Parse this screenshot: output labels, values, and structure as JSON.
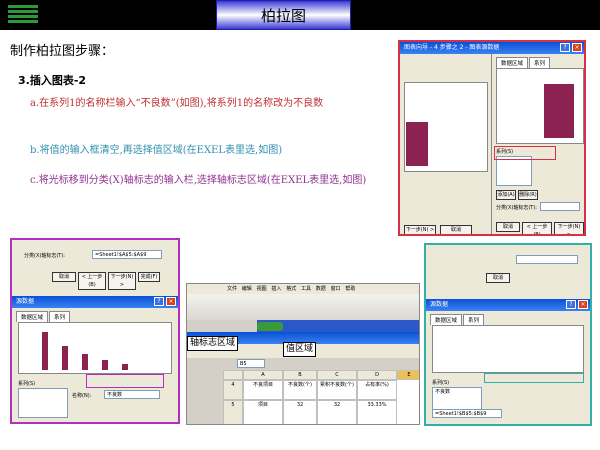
{
  "header": {
    "title": "柏拉图"
  },
  "heading": "制作柏拉图步骤：",
  "subheading": "3.插入图表-2",
  "steps": [
    "a.在系列1的名称栏输入“不良数”(如图),将系列1的名称改为不良数",
    "b.将值的输入框清空,再选择值区域(在EXEL表里选,如图)",
    "c.将光标移到分类(X)轴标志的输入栏,选择轴标志区域(在EXEL表里选,如图)"
  ],
  "colors": {
    "step_a": "#c03030",
    "step_b": "#3090b0",
    "step_c": "#903090",
    "bar": "#8b2252",
    "frame_red": "#d9304a",
    "frame_purple": "#b030c0",
    "frame_teal": "#30b0a8"
  },
  "dialog_right": {
    "title": "图表向导 - 4 步骤之 2 - 图表源数据",
    "tabs": [
      "数据区域",
      "系列"
    ],
    "series_label": "系列(S)",
    "name_label": "名称(N):",
    "value_label": "值(V):",
    "add_button": "添加(A)",
    "remove_button": "删除(R)",
    "axis_label": "分类(X)轴标志(T):",
    "cancel_button": "取消",
    "back_button": "< 上一步(B)",
    "next_button": "下一步(N) >",
    "finish_button": "完成(F)"
  },
  "dialog_left": {
    "title": "源数据",
    "axis_label": "分类(X)轴标志(T):",
    "axis_value": "=Sheet1!$A$5:$A$9",
    "tabs": [
      "数据区域",
      "系列"
    ],
    "series_label": "系列(S)",
    "name_label": "名称(N):",
    "name_value": "不良数",
    "cancel_button": "取消",
    "back_button": "< 上一步(B)",
    "next_button": "下一步(N) >",
    "finish_button": "完成(F)"
  },
  "excel": {
    "menu": [
      "文件",
      "编辑",
      "视图",
      "插入",
      "格式",
      "工具",
      "数据",
      "窗口",
      "帮助"
    ],
    "name_box": "B5",
    "columns": [
      "A",
      "B",
      "C",
      "D",
      "E"
    ],
    "header_row": [
      "不良项目",
      "不良数(个)",
      "累积不良数(个)",
      "占有率(%)"
    ],
    "data_row": [
      "项目",
      "32",
      "32",
      "33.33%"
    ],
    "row_numbers": [
      "4",
      "5"
    ],
    "callout_axis": "轴标志区域",
    "callout_value": "值区域"
  },
  "dialog_small": {
    "title": "源数据",
    "tabs": [
      "数据区域",
      "系列"
    ],
    "series_label": "系列(S)",
    "series_item": "不良数",
    "value_field": "=Sheet1!$B$5:$B$9",
    "cancel_button": "取消"
  }
}
